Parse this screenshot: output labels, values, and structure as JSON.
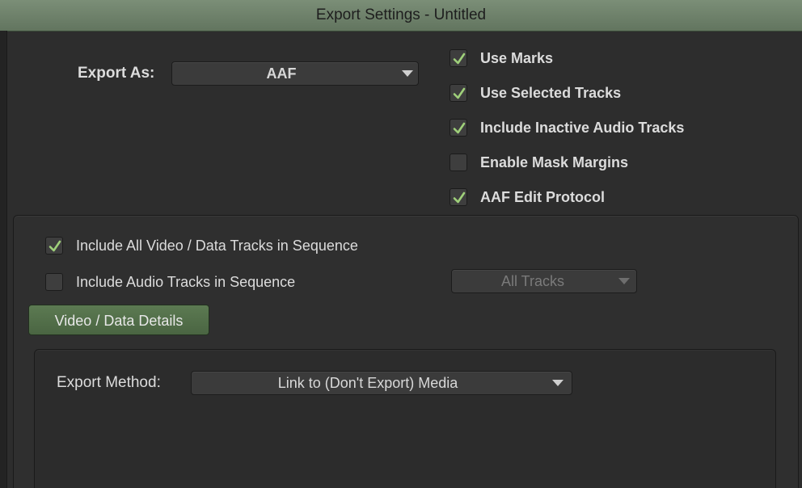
{
  "window": {
    "title": "Export Settings - Untitled"
  },
  "export_as": {
    "label": "Export As:",
    "value": "AAF"
  },
  "options": [
    {
      "label": "Use Marks",
      "checked": true
    },
    {
      "label": "Use Selected Tracks",
      "checked": true
    },
    {
      "label": "Include Inactive Audio Tracks",
      "checked": true
    },
    {
      "label": "Enable Mask Margins",
      "checked": false
    },
    {
      "label": "AAF Edit Protocol",
      "checked": true
    }
  ],
  "tracks": {
    "video": {
      "label": "Include All Video / Data Tracks in Sequence",
      "checked": true
    },
    "audio": {
      "label": "Include Audio Tracks in Sequence",
      "checked": false
    },
    "audio_tracks_dropdown": {
      "value": "All Tracks",
      "enabled": false
    }
  },
  "details_button": {
    "label": "Video / Data Details"
  },
  "export_method": {
    "label": "Export Method:",
    "value": "Link to (Don't Export) Media"
  },
  "colors": {
    "titlebar": "#6b7e67",
    "checkmark": "#9fd07a",
    "button_green": "#52704a"
  }
}
